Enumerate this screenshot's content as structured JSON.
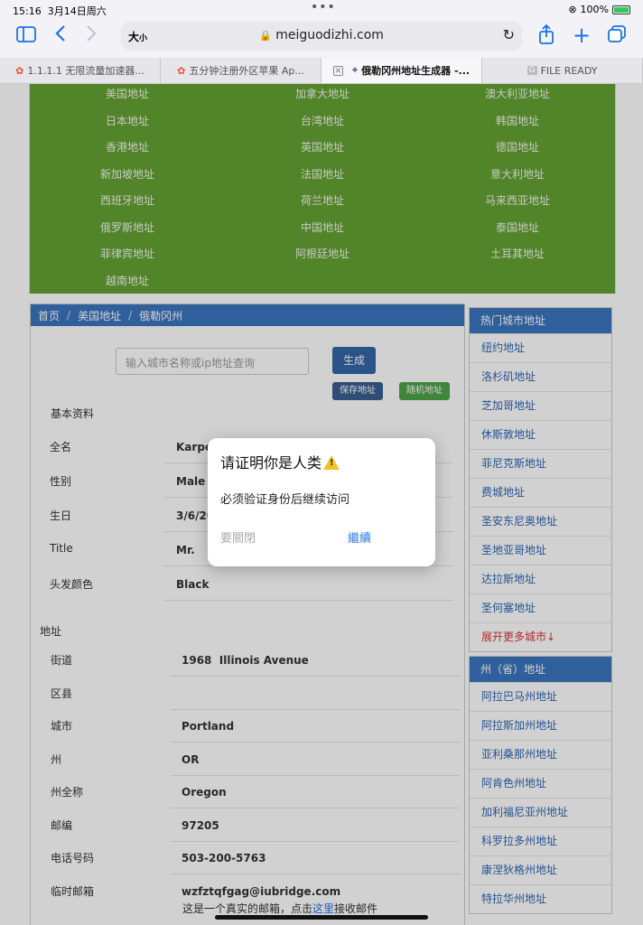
{
  "status_bar": {
    "time": "15:16",
    "date": "3月14日周六",
    "battery": "100%"
  },
  "browser": {
    "text_size_big": "大",
    "text_size_small": "小",
    "host": "meiguodizhi.com",
    "tabs": [
      {
        "title": "1.1.1.1 无限流量加速器..."
      },
      {
        "title": "五分钟注册外区苹果 Ap..."
      },
      {
        "title": "俄勒冈州地址生成器 -..."
      },
      {
        "title": "FILE READY",
        "favicon": "G"
      }
    ]
  },
  "country_links": [
    "美国地址",
    "加拿大地址",
    "澳大利亚地址",
    "日本地址",
    "台湾地址",
    "韩国地址",
    "香港地址",
    "英国地址",
    "德国地址",
    "新加坡地址",
    "法国地址",
    "意大利地址",
    "西班牙地址",
    "荷兰地址",
    "马来西亚地址",
    "俄罗斯地址",
    "中国地址",
    "泰国地址",
    "菲律宾地址",
    "阿根廷地址",
    "土耳其地址",
    "越南地址"
  ],
  "breadcrumb": {
    "home": "首页",
    "country": "美国地址",
    "state": "俄勒冈州"
  },
  "search": {
    "placeholder": "输入城市名称或ip地址查询",
    "generate": "生成",
    "save": "保存地址",
    "random": "随机地址"
  },
  "basic": {
    "title": "基本资料",
    "rows": [
      {
        "label": "全名",
        "value": "Karpe"
      },
      {
        "label": "性别",
        "value": "Male"
      },
      {
        "label": "生日",
        "value": "3/6/20"
      },
      {
        "label": "Title",
        "value": "Mr."
      },
      {
        "label": "头发颜色",
        "value": "Black"
      }
    ]
  },
  "address": {
    "title": "地址",
    "rows": [
      {
        "label": "街道",
        "value": "1968  Illinois Avenue"
      },
      {
        "label": "区县",
        "value": ""
      },
      {
        "label": "城市",
        "value": "Portland"
      },
      {
        "label": "州",
        "value": "OR"
      },
      {
        "label": "州全称",
        "value": "Oregon"
      },
      {
        "label": "邮编",
        "value": "97205"
      },
      {
        "label": "电话号码",
        "value": "503-200-5763"
      },
      {
        "label": "临时邮箱",
        "value": "wzfztqfgag@iubridge.com"
      }
    ],
    "note_prefix": "这是一个真实的邮箱，点击",
    "note_link": "这里",
    "note_suffix": "接收邮件"
  },
  "hot_cities": {
    "title": "热门城市地址",
    "items": [
      "纽约地址",
      "洛杉矶地址",
      "芝加哥地址",
      "休斯敦地址",
      "菲尼克斯地址",
      "费城地址",
      "圣安东尼奥地址",
      "圣地亚哥地址",
      "达拉斯地址",
      "圣何塞地址"
    ],
    "more": "展开更多城市↓"
  },
  "states": {
    "title": "州（省）地址",
    "items": [
      "阿拉巴马州地址",
      "阿拉斯加州地址",
      "亚利桑那州地址",
      "阿肯色州地址",
      "加利福尼亚州地址",
      "科罗拉多州地址",
      "康涅狄格州地址",
      "特拉华州地址"
    ]
  },
  "dialog": {
    "title": "请证明你是人类",
    "message": "必须验证身份后继续访问",
    "dismiss": "要關閉",
    "continue": "繼續"
  },
  "colors": {
    "green_panel": "#64a234",
    "header_blue": "#3a76bd",
    "link_blue": "#2f66b3"
  }
}
